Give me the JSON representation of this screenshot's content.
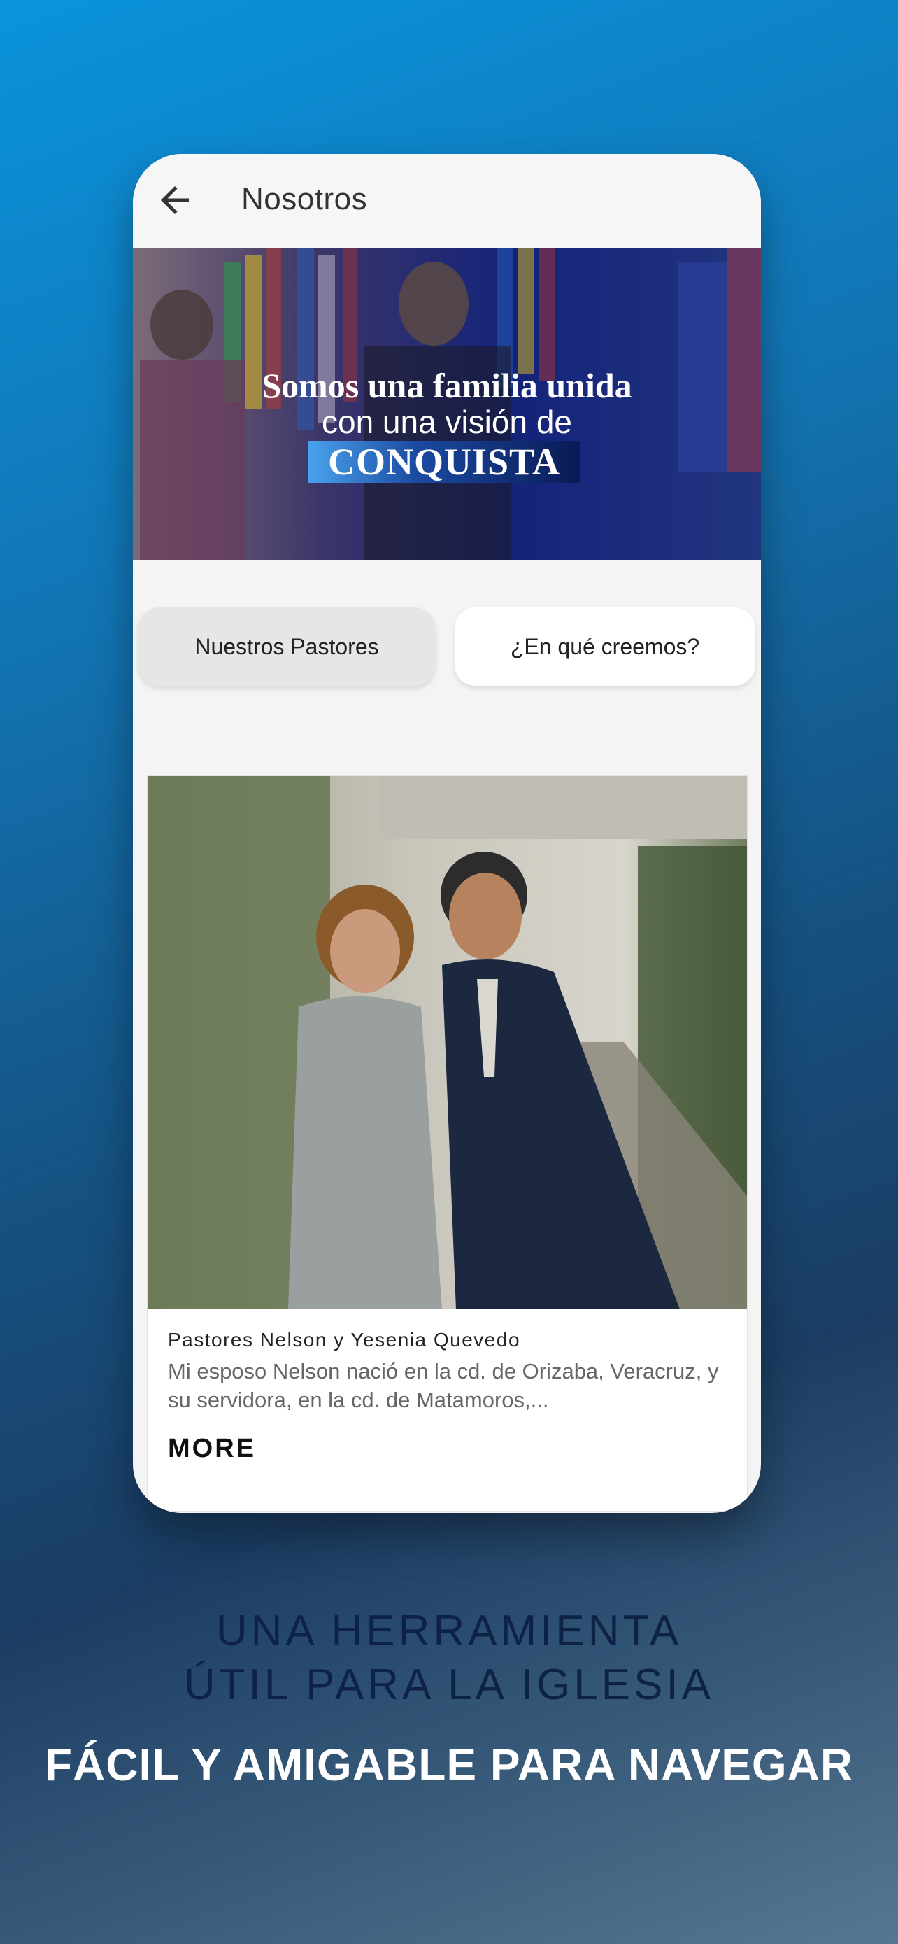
{
  "app": {
    "title": "Nosotros"
  },
  "banner": {
    "line1": "Somos una familia unida",
    "line2": "con una visión de",
    "line3": "CONQUISTA"
  },
  "tabs": [
    {
      "label": "Nuestros Pastores",
      "selected": true
    },
    {
      "label": "¿En qué creemos?",
      "selected": false
    }
  ],
  "card": {
    "name": "Pastores Nelson y Yesenia Quevedo",
    "description": "Mi esposo Nelson nació en la cd. de Orizaba, Veracruz, y su servidora, en la cd. de Matamoros,...",
    "more_label": "MORE"
  },
  "promo": {
    "line1": "UNA HERRAMIENTA",
    "line2": "ÚTIL PARA LA IGLESIA",
    "line3": "FÁCIL Y AMIGABLE PARA NAVEGAR"
  },
  "icons": {
    "back": "arrow-left-icon"
  },
  "colors": {
    "tab_selected_bg": "#e6e6e6",
    "tab_bg": "#ffffff",
    "promo_dark_text": "#0e2247"
  }
}
